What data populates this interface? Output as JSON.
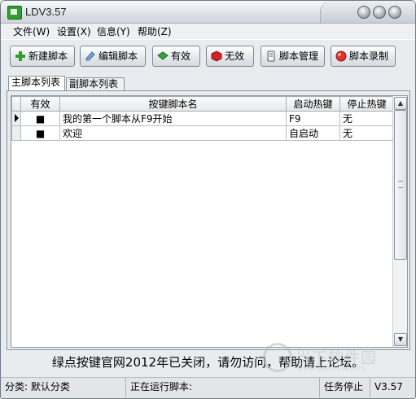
{
  "window": {
    "title": "LDV3.57",
    "controls": [
      "minimize-icon",
      "maximize-icon",
      "close-icon"
    ]
  },
  "menu": [
    {
      "label": "文件(W)"
    },
    {
      "label": "设置(X)"
    },
    {
      "label": "信息(Y)"
    },
    {
      "label": "帮助(Z)"
    }
  ],
  "toolbar": [
    {
      "label": "新建脚本",
      "icon": "plus-icon"
    },
    {
      "label": "编辑脚本",
      "icon": "pencil-icon"
    },
    {
      "label": "有效",
      "icon": "check-icon"
    },
    {
      "label": "无效",
      "icon": "x-icon"
    },
    {
      "label": "脚本管理",
      "icon": "folder-icon"
    },
    {
      "label": "脚本录制",
      "icon": "record-icon"
    }
  ],
  "tabs": [
    {
      "label": "主脚本列表",
      "active": true
    },
    {
      "label": "副脚本列表",
      "active": false
    }
  ],
  "table": {
    "columns": [
      "有效",
      "按键脚本名",
      "启动热键",
      "停止热键"
    ],
    "rows": [
      {
        "enabled": "■",
        "name": "我的第一个脚本从F9开始",
        "start": "F9",
        "stop": "无",
        "selected": true
      },
      {
        "enabled": "■",
        "name": "欢迎",
        "start": "自启动",
        "stop": "无",
        "selected": false
      }
    ]
  },
  "notice": "绿点按键官网2012年已关闭，请勿访问，帮助请上论坛。",
  "status": {
    "category": "分类:  默认分类",
    "running": "正在运行脚本:",
    "task": "任务停止",
    "version": "V3.57"
  },
  "watermark": {
    "text": "当下软件园",
    "url": "www.downxia.com"
  },
  "colors": {
    "title_text": "#222222",
    "window_border": "#6f7a86",
    "plus_green": "#2e9e2e",
    "invalid_red": "#d2232a",
    "record_red": "#e4322b"
  }
}
